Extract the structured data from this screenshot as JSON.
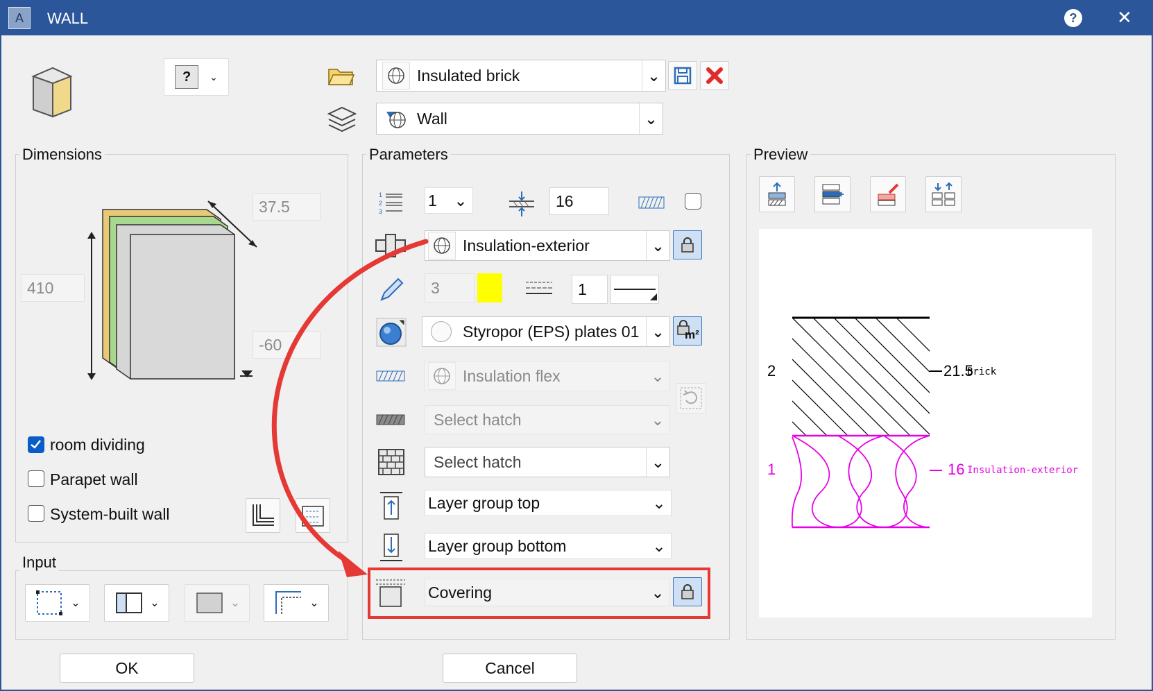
{
  "window": {
    "title": "WALL",
    "app_icon_letter": "A"
  },
  "top": {
    "help_symbol": "?",
    "material": "Insulated brick",
    "layer": "Wall"
  },
  "dimensions": {
    "title": "Dimensions",
    "thickness": "37.5",
    "height": "410",
    "bottom_offset": "-60",
    "checkboxes": [
      {
        "label": "room dividing",
        "checked": true
      },
      {
        "label": "Parapet wall",
        "checked": false
      },
      {
        "label": "System-built wall",
        "checked": false
      }
    ]
  },
  "parameters": {
    "title": "Parameters",
    "layer_number": "1",
    "layer_thickness": "16",
    "component": "Insulation-exterior",
    "pen": "3",
    "linetype": "1",
    "color": "#ffff00",
    "surface": "Styropor (EPS) plates 01",
    "hatch_pattern": "Insulation flex",
    "hatch_1": "Select hatch",
    "hatch_2": "Select hatch",
    "layer_group_top": "Layer group top",
    "layer_group_bottom": "Layer group bottom",
    "covering": "Covering",
    "lock_m2_label": "m²"
  },
  "input": {
    "title": "Input"
  },
  "preview": {
    "title": "Preview",
    "layers": [
      {
        "index": "2",
        "thickness": "21.5",
        "name": "Brick",
        "color": "#000000"
      },
      {
        "index": "1",
        "thickness": "16",
        "name": "Insulation-exterior",
        "color": "#e600e6"
      }
    ]
  },
  "buttons": {
    "ok": "OK",
    "cancel": "Cancel"
  },
  "annotation": {
    "highlight_color": "#e53935"
  }
}
